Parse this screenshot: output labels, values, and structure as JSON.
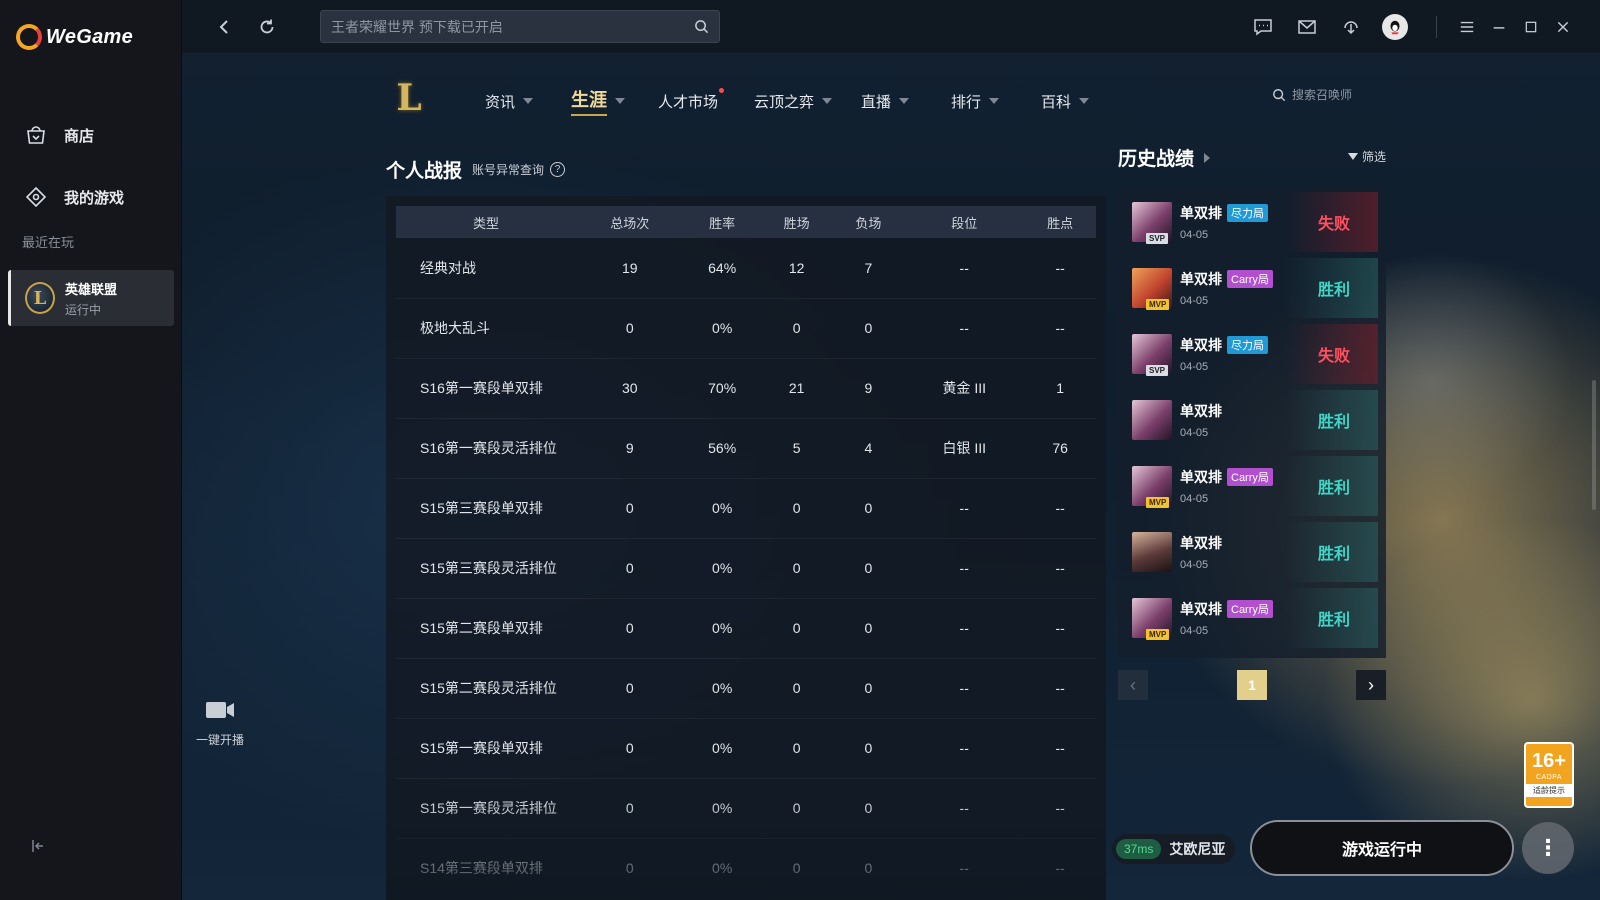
{
  "app": {
    "name": "WeGame"
  },
  "sidebar": {
    "items": [
      {
        "label": "商店",
        "icon": "shop-icon"
      },
      {
        "label": "我的游戏",
        "icon": "gamepad-icon"
      }
    ],
    "recent_label": "最近在玩",
    "recent_game": {
      "title": "英雄联盟",
      "status": "运行中"
    }
  },
  "topbar": {
    "search_placeholder": "王者荣耀世界 预下载已开启"
  },
  "game_nav": {
    "items": [
      {
        "label": "资讯",
        "dropdown": true
      },
      {
        "label": "生涯",
        "dropdown": true,
        "active": true
      },
      {
        "label": "人才市场",
        "dropdown": false,
        "dot": true
      },
      {
        "label": "云顶之弈",
        "dropdown": true
      },
      {
        "label": "直播",
        "dropdown": true
      },
      {
        "label": "排行",
        "dropdown": true
      },
      {
        "label": "百科",
        "dropdown": true
      }
    ],
    "summoner_search_placeholder": "搜索召唤师"
  },
  "stats": {
    "title": "个人战报",
    "abnormal_link": "账号异常查询",
    "columns": [
      "类型",
      "总场次",
      "胜率",
      "胜场",
      "负场",
      "段位",
      "胜点"
    ],
    "rows": [
      [
        "经典对战",
        "19",
        "64%",
        "12",
        "7",
        "--",
        "--"
      ],
      [
        "极地大乱斗",
        "0",
        "0%",
        "0",
        "0",
        "--",
        "--"
      ],
      [
        "S16第一赛段单双排",
        "30",
        "70%",
        "21",
        "9",
        "黄金 III",
        "1"
      ],
      [
        "S16第一赛段灵活排位",
        "9",
        "56%",
        "5",
        "4",
        "白银 III",
        "76"
      ],
      [
        "S15第三赛段单双排",
        "0",
        "0%",
        "0",
        "0",
        "--",
        "--"
      ],
      [
        "S15第三赛段灵活排位",
        "0",
        "0%",
        "0",
        "0",
        "--",
        "--"
      ],
      [
        "S15第二赛段单双排",
        "0",
        "0%",
        "0",
        "0",
        "--",
        "--"
      ],
      [
        "S15第二赛段灵活排位",
        "0",
        "0%",
        "0",
        "0",
        "--",
        "--"
      ],
      [
        "S15第一赛段单双排",
        "0",
        "0%",
        "0",
        "0",
        "--",
        "--"
      ],
      [
        "S15第一赛段灵活排位",
        "0",
        "0%",
        "0",
        "0",
        "--",
        "--"
      ],
      [
        "S14第三赛段单双排",
        "0",
        "0%",
        "0",
        "0",
        "--",
        "--"
      ]
    ]
  },
  "history": {
    "title": "历史战绩",
    "filter_label": "筛选",
    "matches": [
      {
        "mode": "单双排",
        "tag": "尽力局",
        "tag_type": "hard",
        "badge": "SVP",
        "date": "04-05",
        "result": "失败",
        "win": false,
        "avatar": "kai"
      },
      {
        "mode": "单双排",
        "tag": "Carry局",
        "tag_type": "carry",
        "badge": "MVP",
        "date": "04-05",
        "result": "胜利",
        "win": true,
        "avatar": "ahri"
      },
      {
        "mode": "单双排",
        "tag": "尽力局",
        "tag_type": "hard",
        "badge": "SVP",
        "date": "04-05",
        "result": "失败",
        "win": false,
        "avatar": "kai"
      },
      {
        "mode": "单双排",
        "tag": "",
        "tag_type": "",
        "badge": "",
        "date": "04-05",
        "result": "胜利",
        "win": true,
        "avatar": "kai"
      },
      {
        "mode": "单双排",
        "tag": "Carry局",
        "tag_type": "carry",
        "badge": "MVP",
        "date": "04-05",
        "result": "胜利",
        "win": true,
        "avatar": "kai"
      },
      {
        "mode": "单双排",
        "tag": "",
        "tag_type": "",
        "badge": "",
        "date": "04-05",
        "result": "胜利",
        "win": true,
        "avatar": "face"
      },
      {
        "mode": "单双排",
        "tag": "Carry局",
        "tag_type": "carry",
        "badge": "MVP",
        "date": "04-05",
        "result": "胜利",
        "win": true,
        "avatar": "kai"
      }
    ],
    "page": "1"
  },
  "live": {
    "label": "一键开播"
  },
  "age_rating": {
    "number": "16+",
    "org": "CADPA",
    "tip": "适龄提示"
  },
  "status": {
    "ping": "37ms",
    "server": "艾欧尼亚",
    "run_label": "游戏运行中"
  },
  "colors": {
    "win": "#3ed6c6",
    "loss": "#ff5060",
    "accent": "#c9a64f"
  }
}
